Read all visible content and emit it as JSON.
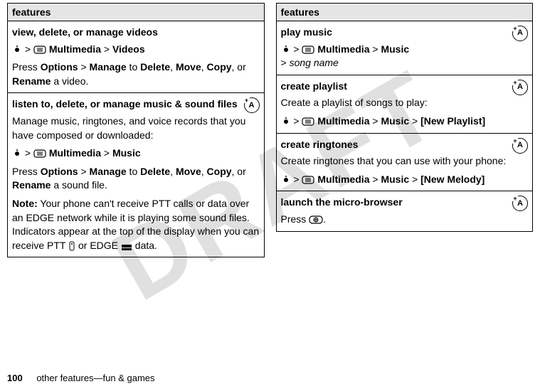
{
  "watermark": "DRAFT",
  "left": {
    "header": "features",
    "s1": {
      "title": "view, delete, or manage videos",
      "path_mm": "Multimedia",
      "path_videos": "Videos",
      "press": "Press ",
      "options": "Options",
      "gt": " > ",
      "manage": "Manage",
      "to": " to ",
      "delete": "Delete",
      "comma": ", ",
      "move": "Move",
      "copy": "Copy",
      "or": ", or ",
      "rename": "Rename",
      "avideo": " a video."
    },
    "s2": {
      "title": "listen to, delete, or manage music & sound files",
      "desc": "Manage music, ringtones, and voice records that you have composed or downloaded:",
      "path_mm": "Multimedia",
      "path_music": "Music",
      "press": "Press ",
      "options": "Options",
      "gt": " > ",
      "manage": "Manage",
      "to": " to ",
      "delete": "Delete",
      "comma": ", ",
      "move": "Move",
      "copy": "Copy",
      "or": ", or ",
      "rename": "Rename",
      "asound": " a sound file.",
      "note_label": "Note:",
      "note_body": " Your phone can't receive PTT calls or data over an EDGE network while it is playing some sound files. Indicators appear at the top of the display when you can receive PTT ",
      "note_body2": " or EDGE ",
      "note_body3": " data."
    }
  },
  "right": {
    "header": "features",
    "s1": {
      "title": "play music",
      "path_mm": "Multimedia",
      "path_music": "Music",
      "gt2": "> ",
      "song": "song name"
    },
    "s2": {
      "title": "create playlist",
      "desc": "Create a playlist of songs to play:",
      "path_mm": "Multimedia",
      "path_music": "Music",
      "new_playlist": "[New Playlist]"
    },
    "s3": {
      "title": "create ringtones",
      "desc": "Create ringtones that you can use with your phone:",
      "path_mm": "Multimedia",
      "path_music": "Music",
      "new_melody": "[New Melody]"
    },
    "s4": {
      "title": "launch the micro-browser",
      "press": "Press ",
      "period": "."
    }
  },
  "badge_letter": "A",
  "footer": {
    "page": "100",
    "text": "other features—fun & games"
  }
}
